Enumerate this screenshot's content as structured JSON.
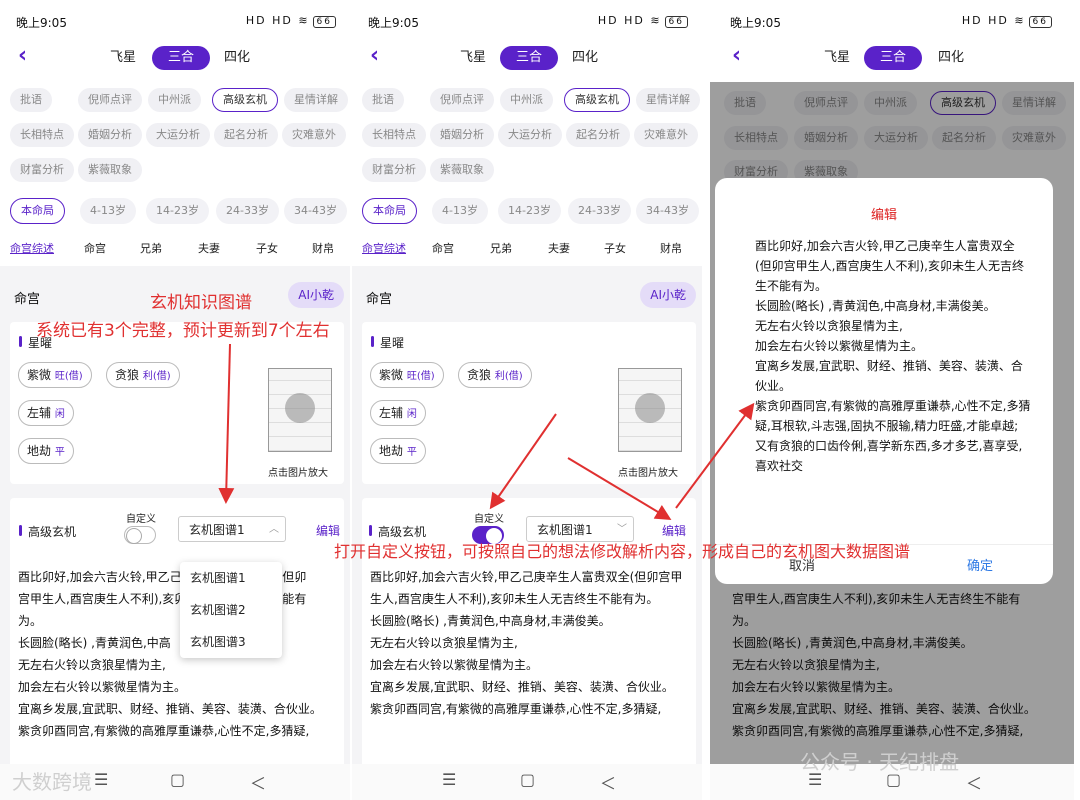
{
  "status": {
    "time": "晚上9:05",
    "signal": "HD HD ≋",
    "battery": "66"
  },
  "tabs": [
    "飞星",
    "三合",
    "四化"
  ],
  "categories_row1": [
    "批语",
    "倪师点评",
    "中州派",
    "高级玄机",
    "星情详解"
  ],
  "categories_row2": [
    "长相特点",
    "婚姻分析",
    "大运分析",
    "起名分析",
    "灾难意外"
  ],
  "categories_row3": [
    "财富分析",
    "紫薇取象"
  ],
  "periods": [
    "本命局",
    "4-13岁",
    "14-23岁",
    "24-33岁",
    "34-43岁"
  ],
  "palaces": [
    "命宫综述",
    "命宫",
    "兄弟",
    "夫妻",
    "子女",
    "财帛"
  ],
  "palace_title": "命宫",
  "ai_button": "AI小乾",
  "stars_title": "星曜",
  "stars": [
    {
      "name": "紫微",
      "status": "旺(借)"
    },
    {
      "name": "贪狼",
      "status": "利(借)"
    },
    {
      "name": "左辅",
      "status": "闲"
    },
    {
      "name": "地劫",
      "status": "平"
    }
  ],
  "chart_caption": "点击图片放大",
  "advanced_title": "高级玄机",
  "custom_label": "自定义",
  "select_value": "玄机图谱1",
  "select_caret": "︿",
  "select_caret_closed": "﹀",
  "edit_label": "编辑",
  "dropdown_options": [
    "玄机图谱1",
    "玄机图谱2",
    "玄机图谱3"
  ],
  "body_lines": [
    "酉比卯好,加会六吉火铃,甲乙己庚辛生人富贵双全(但卯宫甲生人,酉宫庚生人不利),亥卯未生人无吉终生不能有为。",
    "长圆脸(略长) ,青黄润色,中高身材,丰满俊美。",
    "无左右火铃以贪狼星情为主,",
    "加会左右火铃以紫微星情为主。",
    "宜离乡发展,宜武职、财经、推销、美容、装潢、合伙业。",
    "",
    "紫贪卯酉同宫,有紫微的高雅厚重谦恭,心性不定,多猜疑,"
  ],
  "panel1_lines": [
    "酉比卯好,加会六吉火铃,甲乙己庚辛生人富贵双全(但卯",
    "宫甲生人,酉宫庚生人不利),亥卯未生人无吉终生不能有",
    "为。",
    "长圆脸(略长) ,青黄润色,中高",
    "无左右火铃以贪狼星情为主,",
    "加会左右火铃以紫微星情为主。",
    "宜离乡发展,宜武职、财经、推销、美容、装潢、合伙业。",
    "",
    "紫贪卯酉同宫,有紫微的高雅厚重谦恭,心性不定,多猜疑,"
  ],
  "panel3_lines": [
    "宫甲生人,酉宫庚生人不利),亥卯未生人无吉终生不能有",
    "为。",
    "长圆脸(略长) ,青黄润色,中高身材,丰满俊美。",
    "无左右火铃以贪狼星情为主,",
    "加会左右火铃以紫微星情为主。",
    "宜离乡发展,宜武职、财经、推销、美容、装潢、合伙业。",
    "",
    "紫贪卯酉同宫,有紫微的高雅厚重谦恭,心性不定,多猜疑,"
  ],
  "dialog": {
    "title": "编辑",
    "lines": [
      "酉比卯好,加会六吉火铃,甲乙己庚辛生人富贵双全(但卯宫甲生人,酉宫庚生人不利),亥卯未生人无吉终生不能有为。",
      "长圆脸(略长) ,青黄润色,中高身材,丰满俊美。",
      "无左右火铃以贪狼星情为主,",
      "加会左右火铃以紫微星情为主。",
      "宜离乡发展,宜武职、财经、推销、美容、装潢、合伙业。",
      "",
      "紫贪卯酉同宫,有紫微的高雅厚重谦恭,心性不定,多猜疑,耳根软,斗志强,固执不服输,精力旺盛,才能卓越;",
      "又有贪狼的口齿伶俐,喜学新东西,多才多艺,喜享受,喜欢社交"
    ],
    "cancel": "取消",
    "confirm": "确定"
  },
  "annotations": {
    "a1": "玄机知识图谱",
    "a2": "系统已有3个完整，预计更新到7个左右",
    "a3": "打开自定义按钮，可按照自己的想法修改解析内容，形成自己的玄机图大数据图谱"
  },
  "watermarks": {
    "left": "大数跨境",
    "right": "公众号 · 天纪排盘"
  },
  "sysnav": {
    "menu": "☰",
    "home": "▢",
    "back": "＜"
  },
  "colors": {
    "accent": "#5a22c9",
    "annotation": "#e03030",
    "dialog_title": "#d22222"
  }
}
